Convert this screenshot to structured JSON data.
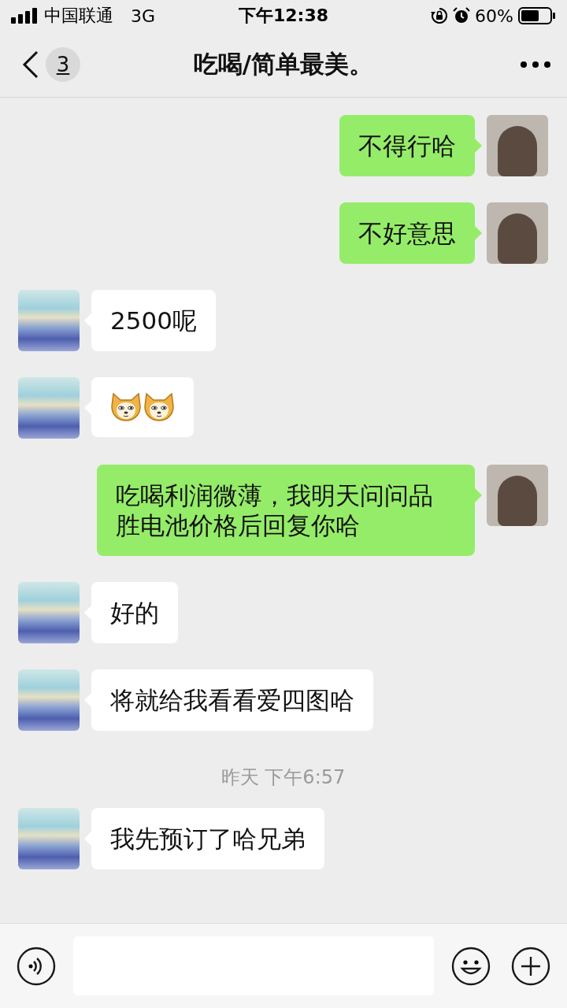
{
  "status_bar": {
    "carrier": "中国联通",
    "network": "3G",
    "time": "下午12:38",
    "battery": "60%"
  },
  "nav": {
    "badge": "3",
    "title": "吃喝/简单最美。"
  },
  "messages": [
    {
      "kind": "sent",
      "text": "不得行哈"
    },
    {
      "kind": "sent",
      "text": "不好意思"
    },
    {
      "kind": "received",
      "text": "2500呢"
    },
    {
      "kind": "received_emoji",
      "items": [
        {
          "kind": "dog"
        },
        {
          "kind": "dog"
        }
      ]
    },
    {
      "kind": "sent",
      "text": "吃喝利润微薄，我明天问问品胜电池价格后回复你哈"
    },
    {
      "kind": "received",
      "text": "好的"
    },
    {
      "kind": "received",
      "text": "将就给我看看爱四图哈"
    },
    {
      "kind": "time",
      "text": "昨天 下午6:57"
    },
    {
      "kind": "received",
      "text": "我先预订了哈兄弟"
    }
  ]
}
